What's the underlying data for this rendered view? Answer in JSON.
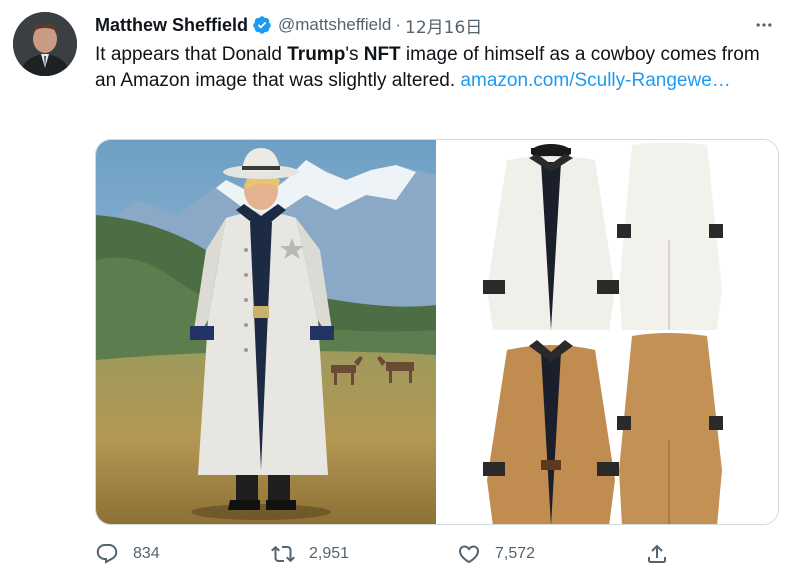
{
  "author": {
    "name": "Matthew Sheffield",
    "handle": "@mattsheffield",
    "separator": "·",
    "date": "12月16日"
  },
  "tweet": {
    "text_part1": "It appears that Donald ",
    "text_bold1": "Trump",
    "text_part2": "'s ",
    "text_bold2": "NFT",
    "text_part3": " image of himself as a cowboy comes from an Amazon image that was slightly altered. ",
    "link_text": "amazon.com/Scully-Rangewe…"
  },
  "actions": {
    "reply_count": "834",
    "retweet_count": "2,951",
    "like_count": "7,572"
  },
  "icons": {
    "verified": "verified-badge-icon",
    "more": "more-options-icon",
    "reply": "reply-icon",
    "retweet": "retweet-icon",
    "like": "heart-icon",
    "share": "share-icon"
  },
  "colors": {
    "link": "#1d9bf0",
    "muted": "#536471",
    "text": "#0f1419",
    "verified": "#1d9bf0"
  }
}
